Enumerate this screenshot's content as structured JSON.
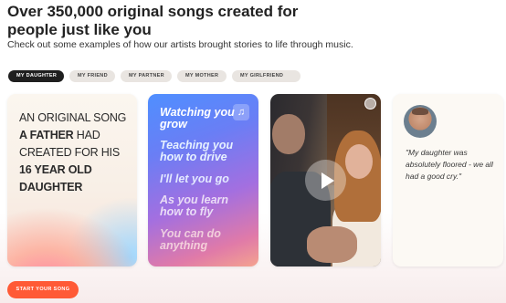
{
  "headline": "Over 350,000 original songs created for people just like you",
  "subheadline": "Check out some examples of how our artists brought stories to life through music.",
  "tabs": [
    {
      "label": "MY DAUGHTER",
      "active": true
    },
    {
      "label": "MY FRIEND",
      "active": false
    },
    {
      "label": "MY PARTNER",
      "active": false
    },
    {
      "label": "MY MOTHER",
      "active": false
    },
    {
      "label": "MY GIRLFRIEND",
      "active": false
    }
  ],
  "card1": {
    "line1": "AN ORIGINAL SONG",
    "line2a": "A FATHER",
    "line2b": " HAD",
    "line3": "CREATED FOR HIS",
    "line4": "16 YEAR OLD",
    "line5": "DAUGHTER"
  },
  "card2": {
    "lyrics": [
      "Watching you grow",
      "Teaching you how to drive",
      "I'll let you go",
      "As you learn how to fly",
      "You can do anything"
    ],
    "icon": "music-note-icon"
  },
  "card3": {
    "icon": "play-icon"
  },
  "card4": {
    "quote": "\"My daughter was absolutely floored - we all had a good cry.\""
  },
  "cta": {
    "label": "START YOUR SONG"
  },
  "colors": {
    "accent": "#ff5a36",
    "active_tab": "#1f1f1f",
    "tab_bg": "#e9e5e1"
  }
}
